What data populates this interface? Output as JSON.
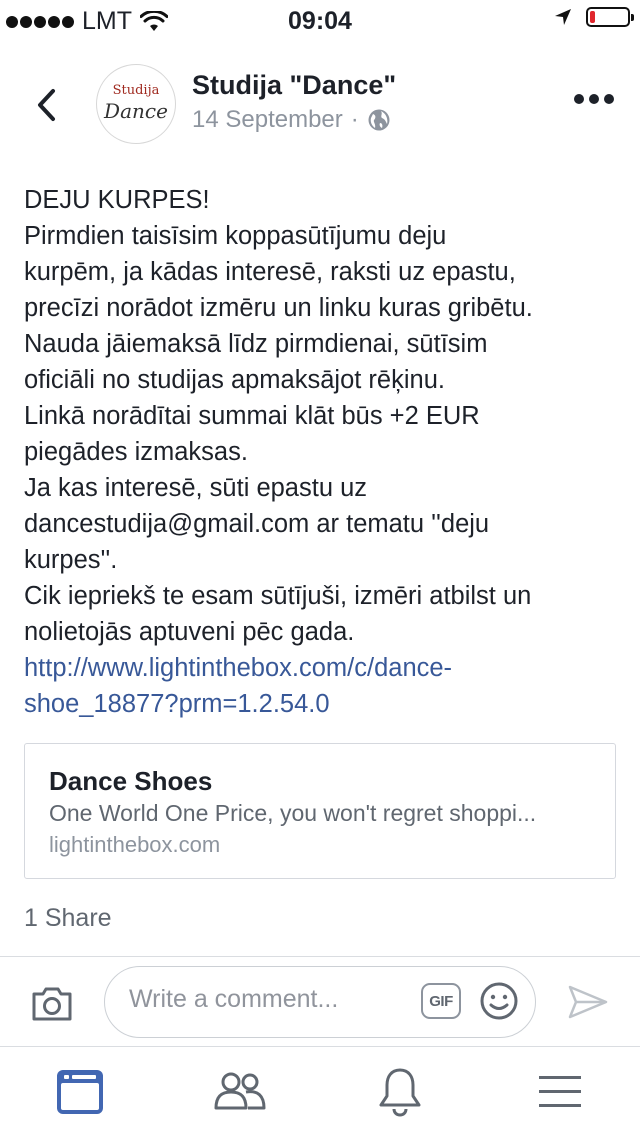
{
  "status_bar": {
    "carrier": "LMT",
    "time": "09:04",
    "battery_level": 0.15,
    "battery_color": "#e0262d"
  },
  "post": {
    "page_name": "Studija \"Dance\"",
    "date": "14 September",
    "separator": "·",
    "privacy_icon": "globe-icon",
    "avatar": {
      "logo_top": "Studija",
      "logo_bottom": "Dance"
    },
    "body_lines": [
      "DEJU KURPES!",
      "Pirmdien taisīsim koppasūtījumu deju",
      "kurpēm, ja kādas interesē, raksti uz epastu,",
      "precīzi norādot izmēru un linku kuras gribētu.",
      "Nauda jāiemaksā līdz pirmdienai, sūtīsim",
      "oficiāli no studijas apmaksājot rēķinu.",
      "Linkā norādītai summai klāt būs +2 EUR",
      "piegādes izmaksas.",
      "Ja kas interesē, sūti epastu uz",
      "dancestudija@gmail.com ar tematu ''deju",
      "kurpes''.",
      "Cik iepriekš te esam sūtījuši, izmēri atbilst un",
      "nolietojās aptuveni pēc gada."
    ],
    "link_lines": [
      "http://www.lightinthebox.com/c/dance-",
      "shoe_18877?prm=1.2.54.0"
    ],
    "link_color": "#385898",
    "link_card": {
      "title": "Dance Shoes",
      "description": "One World One Price, you won't regret shoppi...",
      "domain": "lightinthebox.com"
    },
    "shares": "1 Share"
  },
  "comment_bar": {
    "placeholder": "Write a comment...",
    "gif_label": "GIF",
    "camera_icon": "camera-icon",
    "emoji_icon": "emoji-icon",
    "send_icon": "send-icon"
  },
  "tab_bar": {
    "active_color": "#4267b2",
    "items": [
      {
        "icon": "news-feed-icon",
        "active": true
      },
      {
        "icon": "friends-icon",
        "active": false
      },
      {
        "icon": "notifications-icon",
        "active": false
      },
      {
        "icon": "menu-icon",
        "active": false
      }
    ]
  }
}
